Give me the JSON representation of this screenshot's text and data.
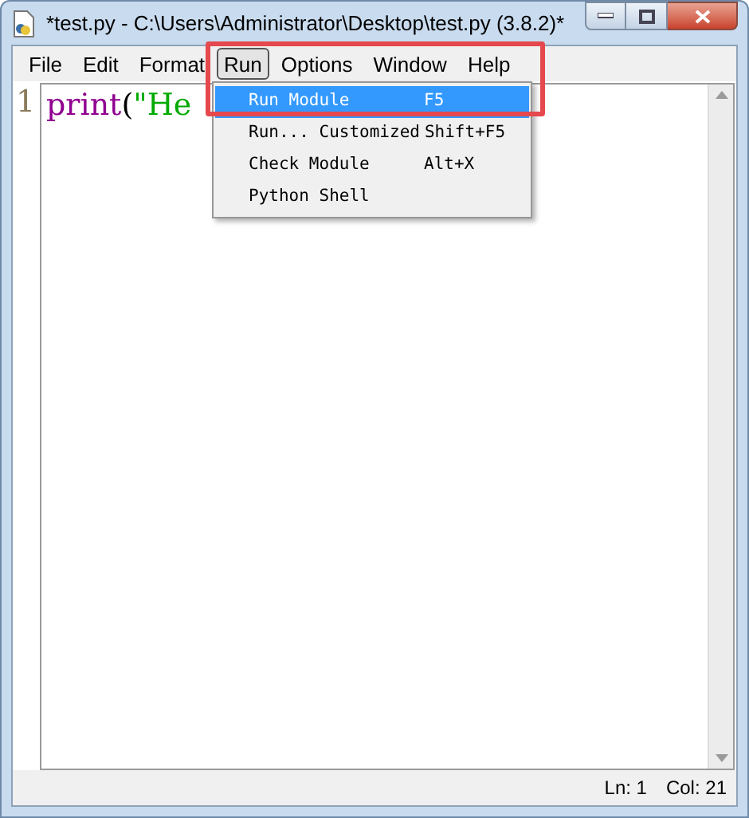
{
  "window": {
    "title": "*test.py - C:\\Users\\Administrator\\Desktop\\test.py (3.8.2)*"
  },
  "menubar": [
    {
      "label": "File",
      "selected": false
    },
    {
      "label": "Edit",
      "selected": false
    },
    {
      "label": "Format",
      "selected": false
    },
    {
      "label": "Run",
      "selected": true
    },
    {
      "label": "Options",
      "selected": false
    },
    {
      "label": "Window",
      "selected": false
    },
    {
      "label": "Help",
      "selected": false
    }
  ],
  "run_menu": [
    {
      "label": "Run Module",
      "shortcut": "F5",
      "selected": true
    },
    {
      "label": "Run... Customized",
      "shortcut": "Shift+F5",
      "selected": false
    },
    {
      "label": "Check Module",
      "shortcut": "Alt+X",
      "selected": false
    },
    {
      "label": "Python Shell",
      "selected": false
    }
  ],
  "editor": {
    "line_number": "1",
    "code": [
      {
        "kind": "builtin",
        "text": "print"
      },
      {
        "kind": "plain",
        "text": "("
      },
      {
        "kind": "string",
        "text": "\"He"
      }
    ]
  },
  "status_bar": {
    "line": "Ln: 1",
    "column": "Col: 21"
  }
}
